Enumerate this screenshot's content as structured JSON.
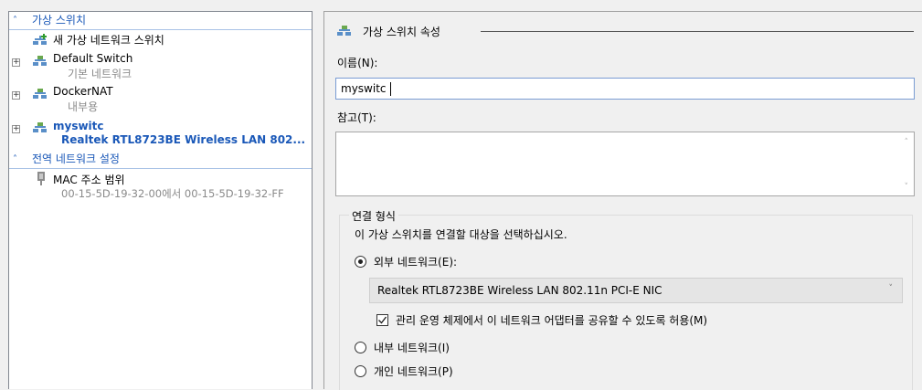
{
  "tree": {
    "section_switches": "가상 스위치",
    "new_switch": "새 가상 네트워크 스위치",
    "switches": [
      {
        "name": "Default Switch",
        "sub": "기본 네트워크"
      },
      {
        "name": "DockerNAT",
        "sub": "내부용"
      },
      {
        "name": "myswitc",
        "sub": "Realtek RTL8723BE Wireless LAN 802..."
      }
    ],
    "section_global": "전역 네트워크 설정",
    "mac_label": "MAC 주소 범위",
    "mac_range": "00-15-5D-19-32-00에서 00-15-5D-19-32-FF"
  },
  "props": {
    "header": "가상 스위치 속성",
    "name_label": "이름(N):",
    "name_value": "myswitc",
    "notes_label": "참고(T):",
    "connection_group": "연결 형식",
    "connection_prompt": "이 가상 스위치를 연결할 대상을 선택하십시오.",
    "external_label": "외부 네트워크(E):",
    "adapter_value": "Realtek RTL8723BE Wireless LAN 802.11n PCI-E NIC",
    "share_label": "관리 운영 체제에서 이 네트워크 어댑터를 공유할 수 있도록 허용(M)",
    "share_checked": true,
    "internal_label": "내부 네트워크(I)",
    "private_label": "개인 네트워크(P)",
    "selected_connection": "external"
  },
  "colors": {
    "accent": "#1a58b8",
    "section_line": "#a9c2e6",
    "muted_text": "#8a8a8a"
  }
}
